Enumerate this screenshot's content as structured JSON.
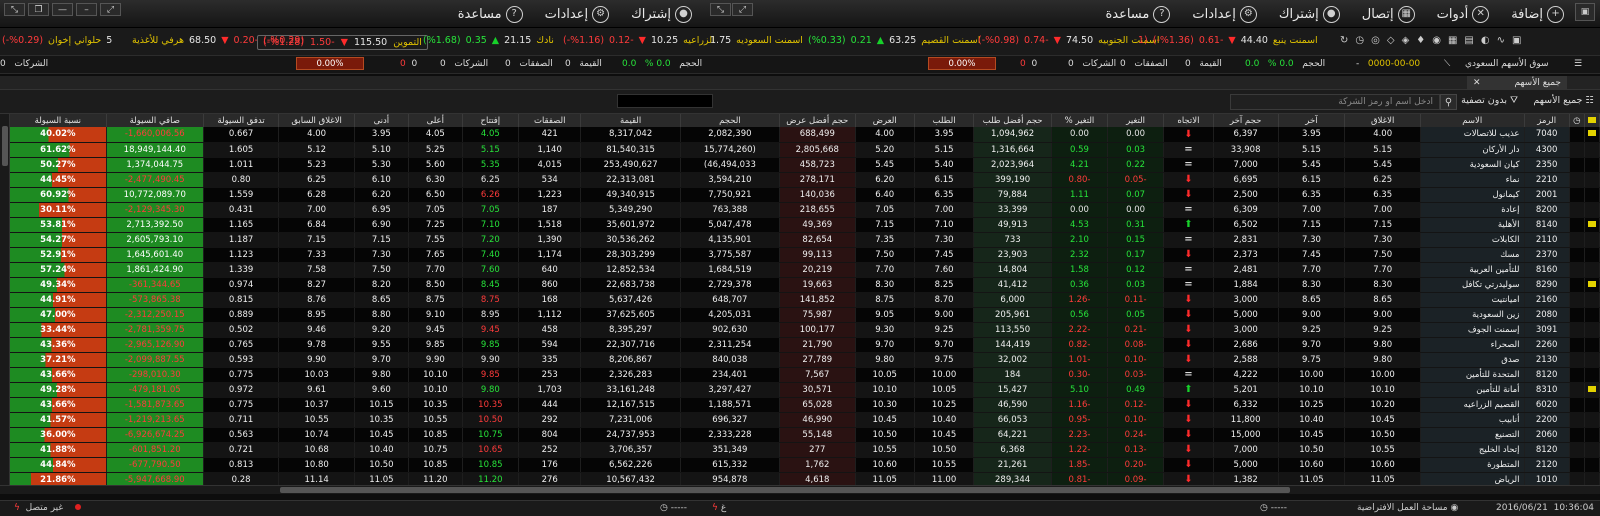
{
  "menu_right": [
    {
      "label": "إضافة",
      "icon": "add-window-icon"
    },
    {
      "label": "أدوات",
      "icon": "tools-icon"
    },
    {
      "label": "إتصال",
      "icon": "connection-icon"
    },
    {
      "label": "إشتراك",
      "icon": "subscription-icon"
    },
    {
      "label": "إعدادات",
      "icon": "gear-icon"
    },
    {
      "label": "مساعدة",
      "icon": "help-icon"
    }
  ],
  "menu_left": [
    {
      "label": "إشتراك",
      "icon": "subscription-icon"
    },
    {
      "label": "إعدادات",
      "icon": "gear-icon"
    },
    {
      "label": "مساعدة",
      "icon": "help-icon"
    }
  ],
  "ticker": [
    {
      "name": "حلواني إخوان",
      "value": "",
      "change": "-0.29",
      "pct": "(%0.29-)",
      "dir": "down"
    },
    {
      "name": "هرفي للأغذية",
      "value": "68.50",
      "change": "-0.20",
      "pct": "(%0.29-)",
      "dir": "down"
    },
    {
      "name": "التموين",
      "value": "115.50",
      "change": "-1.50",
      "pct": "(%1.28-)",
      "dir": "down"
    },
    {
      "name": "نادك",
      "value": "21.15",
      "change": "0.35",
      "pct": "(%1.68)",
      "dir": "up"
    },
    {
      "name": "الزراعيه",
      "value": "10.25",
      "change": "-0.12",
      "pct": "(%1.16-)",
      "dir": "down"
    },
    {
      "name": "اسمنت السعوديه",
      "value": "",
      "change": "",
      "pct": "",
      "dir": ""
    },
    {
      "name": "اسمنت القصيم",
      "value": "63.25",
      "change": "0.21",
      "pct": "(%0.33)",
      "dir": "up"
    },
    {
      "name": "اسمنت الجنوبيه",
      "value": "74.50",
      "change": "-0.74",
      "pct": "(%0.98-)",
      "dir": "down"
    },
    {
      "name": "اسمنت ينبع",
      "value": "44.40",
      "change": "-0.61",
      "pct": "(%1.36-)",
      "dir": "down"
    }
  ],
  "ticker_extra": {
    "a": "1.75",
    "b": "5",
    "c": "(1"
  },
  "stats_right": {
    "market": "سوق الأسهم السعودي",
    "date": "0000-00-00",
    "index": "0.0",
    "pct": "0.0 %",
    "volume_label": "الحجم",
    "volume": "0",
    "value_label": "القيمة",
    "value": "0",
    "deals_label": "الصفقات",
    "deals": "0",
    "companies_label": "الشركات",
    "companies": "0",
    "bar": "0.00%",
    "dash": "-"
  },
  "stats_left": {
    "index": "0.0",
    "pct": "0.0 %",
    "volume_label": "الحجم",
    "volume": "0",
    "value_label": "القيمة",
    "value": "0",
    "deals_label": "الصفقات",
    "deals": "0",
    "companies_label": "الشركات",
    "companies": "0",
    "bar": "0.00%"
  },
  "tab": {
    "label": "جميع الأسهم",
    "close": "✕"
  },
  "toolbar": {
    "all_stocks": "جميع الأسهم",
    "filter": "بدون تصفية",
    "search_placeholder": "ادخل اسم او رمز الشركة"
  },
  "columns": [
    "",
    "",
    "الرمز",
    "الاسم",
    "الاغلاق",
    "آخر",
    "حجم آخر",
    "الاتجاه",
    "التغير",
    "التغير %",
    "حجم أفضل طلب",
    "الطلب",
    "العرض",
    "حجم أفضل عرض",
    "الحجم",
    "القيمة",
    "الصفقات",
    "إفتتاح",
    "أعلى",
    "أدنى",
    "الاغلاق السابق",
    "تدفق السيولة",
    "صافي السيولة",
    "نسبة السيولة"
  ],
  "rows": [
    {
      "flag": true,
      "code": "7040",
      "name": "عذيب للاتصالات",
      "close": "4.00",
      "last": "3.95",
      "lastvol": "6,397",
      "dir": "down",
      "ch": "0.00",
      "pct": "0.00",
      "bidv": "1,094,962",
      "bid": "3.95",
      "ask": "4.00",
      "askv": "688,499",
      "vol": "2,082,390",
      "val": "8,317,042",
      "deals": "421",
      "open": "4.05",
      "high": "4.05",
      "low": "3.95",
      "prev": "4.00",
      "flow": "0.667",
      "net": "1,660,006.56-",
      "ratio": "40.02%",
      "r": 40,
      "cc": "w",
      "oc": "g"
    },
    {
      "flag": false,
      "code": "4300",
      "name": "دار الأركان",
      "close": "5.15",
      "last": "5.15",
      "lastvol": "33,908",
      "dir": "eq",
      "ch": "0.03",
      "pct": "0.59",
      "bidv": "1,316,664",
      "bid": "5.15",
      "ask": "5.20",
      "askv": "2,805,668",
      "vol": "(15,774,260",
      "val": "81,540,315",
      "deals": "1,140",
      "open": "5.15",
      "high": "5.25",
      "low": "5.10",
      "prev": "5.12",
      "flow": "1.605",
      "net": "18,949,144.40",
      "ratio": "61.62%",
      "r": 62,
      "cc": "g",
      "oc": "g"
    },
    {
      "flag": false,
      "code": "2350",
      "name": "كيان السعودية",
      "close": "5.45",
      "last": "5.45",
      "lastvol": "7,000",
      "dir": "eq",
      "ch": "0.22",
      "pct": "4.21",
      "bidv": "2,023,964",
      "bid": "5.40",
      "ask": "5.45",
      "askv": "458,723",
      "vol": "46,494,033)",
      "val": "253,490,627",
      "deals": "4,015",
      "open": "5.35",
      "high": "5.60",
      "low": "5.30",
      "prev": "5.23",
      "flow": "1.011",
      "net": "1,374,044.75",
      "ratio": "50.27%",
      "r": 50,
      "cc": "g",
      "oc": "g"
    },
    {
      "flag": false,
      "code": "2210",
      "name": "نماء",
      "close": "6.25",
      "last": "6.15",
      "lastvol": "6,695",
      "dir": "down",
      "ch": "-0.05",
      "pct": "-0.80",
      "bidv": "399,190",
      "bid": "6.15",
      "ask": "6.20",
      "askv": "278,171",
      "vol": "3,594,210",
      "val": "22,313,081",
      "deals": "534",
      "open": "6.25",
      "high": "6.30",
      "low": "6.10",
      "prev": "6.25",
      "flow": "0.80",
      "net": "2,477,490.45-",
      "ratio": "44.45%",
      "r": 44,
      "cc": "r",
      "oc": "w"
    },
    {
      "flag": false,
      "code": "2001",
      "name": "كيمانول",
      "close": "6.35",
      "last": "6.35",
      "lastvol": "2,500",
      "dir": "down",
      "ch": "0.07",
      "pct": "1.11",
      "bidv": "79,884",
      "bid": "6.35",
      "ask": "6.40",
      "askv": "140,036",
      "vol": "7,750,921",
      "val": "49,340,915",
      "deals": "1,223",
      "open": "6.26",
      "high": "6.50",
      "low": "6.20",
      "prev": "6.28",
      "flow": "1.559",
      "net": "10,772,089.70",
      "ratio": "60.92%",
      "r": 61,
      "cc": "g",
      "oc": "r"
    },
    {
      "flag": false,
      "code": "8200",
      "name": "إعادة",
      "close": "7.00",
      "last": "7.00",
      "lastvol": "6,309",
      "dir": "eq",
      "ch": "0.00",
      "pct": "0.00",
      "bidv": "33,399",
      "bid": "7.00",
      "ask": "7.05",
      "askv": "218,655",
      "vol": "763,388",
      "val": "5,349,290",
      "deals": "187",
      "open": "7.05",
      "high": "7.05",
      "low": "6.95",
      "prev": "7.00",
      "flow": "0.431",
      "net": "2,129,345.30-",
      "ratio": "30.11%",
      "r": 30,
      "cc": "w",
      "oc": "g"
    },
    {
      "flag": true,
      "code": "8140",
      "name": "الأهلية",
      "close": "7.15",
      "last": "7.15",
      "lastvol": "6,502",
      "dir": "up",
      "ch": "0.31",
      "pct": "4.53",
      "bidv": "49,913",
      "bid": "7.10",
      "ask": "7.15",
      "askv": "49,369",
      "vol": "5,047,478",
      "val": "35,601,972",
      "deals": "1,518",
      "open": "7.10",
      "high": "7.25",
      "low": "6.90",
      "prev": "6.84",
      "flow": "1.165",
      "net": "2,713,392.50",
      "ratio": "53.81%",
      "r": 54,
      "cc": "g",
      "oc": "g"
    },
    {
      "flag": false,
      "code": "2110",
      "name": "الكابلات",
      "close": "7.30",
      "last": "7.30",
      "lastvol": "2,831",
      "dir": "eq",
      "ch": "0.15",
      "pct": "2.10",
      "bidv": "733",
      "bid": "7.30",
      "ask": "7.35",
      "askv": "82,654",
      "vol": "4,135,901",
      "val": "30,536,262",
      "deals": "1,390",
      "open": "7.20",
      "high": "7.55",
      "low": "7.15",
      "prev": "7.15",
      "flow": "1.187",
      "net": "2,605,793.10",
      "ratio": "54.27%",
      "r": 54,
      "cc": "g",
      "oc": "g"
    },
    {
      "flag": false,
      "code": "2370",
      "name": "مسك",
      "close": "7.50",
      "last": "7.45",
      "lastvol": "2,373",
      "dir": "down",
      "ch": "0.17",
      "pct": "2.32",
      "bidv": "23,903",
      "bid": "7.45",
      "ask": "7.50",
      "askv": "99,113",
      "vol": "3,775,587",
      "val": "28,303,299",
      "deals": "1,174",
      "open": "7.40",
      "high": "7.65",
      "low": "7.30",
      "prev": "7.33",
      "flow": "1.123",
      "net": "1,645,601.40",
      "ratio": "52.91%",
      "r": 53,
      "cc": "g",
      "oc": "g"
    },
    {
      "flag": false,
      "code": "8160",
      "name": "للتأمين العربية",
      "close": "7.70",
      "last": "7.70",
      "lastvol": "2,481",
      "dir": "eq",
      "ch": "0.12",
      "pct": "1.58",
      "bidv": "14,804",
      "bid": "7.60",
      "ask": "7.70",
      "askv": "20,219",
      "vol": "1,684,519",
      "val": "12,852,534",
      "deals": "640",
      "open": "7.60",
      "high": "7.70",
      "low": "7.50",
      "prev": "7.58",
      "flow": "1.339",
      "net": "1,861,424.90",
      "ratio": "57.24%",
      "r": 57,
      "cc": "g",
      "oc": "g"
    },
    {
      "flag": true,
      "code": "8290",
      "name": "سوليدرتي تكافل",
      "close": "8.30",
      "last": "8.30",
      "lastvol": "1,884",
      "dir": "eq",
      "ch": "0.03",
      "pct": "0.36",
      "bidv": "41,412",
      "bid": "8.25",
      "ask": "8.30",
      "askv": "19,663",
      "vol": "2,729,378",
      "val": "22,683,738",
      "deals": "860",
      "open": "8.45",
      "high": "8.50",
      "low": "8.20",
      "prev": "8.27",
      "flow": "0.974",
      "net": "361,344.65-",
      "ratio": "49.34%",
      "r": 49,
      "cc": "g",
      "oc": "g"
    },
    {
      "flag": false,
      "code": "2160",
      "name": "اميانتيت",
      "close": "8.65",
      "last": "8.65",
      "lastvol": "3,000",
      "dir": "down",
      "ch": "-0.11",
      "pct": "-1.26",
      "bidv": "6,000",
      "bid": "8.70",
      "ask": "8.75",
      "askv": "141,852",
      "vol": "648,707",
      "val": "5,637,426",
      "deals": "168",
      "open": "8.75",
      "high": "8.75",
      "low": "8.65",
      "prev": "8.76",
      "flow": "0.815",
      "net": "573,865.38-",
      "ratio": "44.91%",
      "r": 45,
      "cc": "r",
      "oc": "r"
    },
    {
      "flag": false,
      "code": "2080",
      "name": "زين السعودية",
      "close": "9.00",
      "last": "9.00",
      "lastvol": "5,000",
      "dir": "down",
      "ch": "0.05",
      "pct": "0.56",
      "bidv": "205,961",
      "bid": "9.00",
      "ask": "9.05",
      "askv": "75,987",
      "vol": "4,205,031",
      "val": "37,625,605",
      "deals": "1,112",
      "open": "8.95",
      "high": "9.10",
      "low": "8.80",
      "prev": "8.95",
      "flow": "0.889",
      "net": "2,312,250.15-",
      "ratio": "47.00%",
      "r": 47,
      "cc": "g",
      "oc": "w"
    },
    {
      "flag": false,
      "code": "3091",
      "name": "إسمنت الجوف",
      "close": "9.25",
      "last": "9.25",
      "lastvol": "3,000",
      "dir": "down",
      "ch": "-0.21",
      "pct": "-2.22",
      "bidv": "113,550",
      "bid": "9.25",
      "ask": "9.30",
      "askv": "100,177",
      "vol": "902,630",
      "val": "8,395,297",
      "deals": "458",
      "open": "9.45",
      "high": "9.45",
      "low": "9.20",
      "prev": "9.46",
      "flow": "0.502",
      "net": "2,781,359.75-",
      "ratio": "33.44%",
      "r": 33,
      "cc": "r",
      "oc": "r"
    },
    {
      "flag": false,
      "code": "2260",
      "name": "الصحراء",
      "close": "9.80",
      "last": "9.70",
      "lastvol": "2,686",
      "dir": "down",
      "ch": "-0.08",
      "pct": "-0.82",
      "bidv": "144,419",
      "bid": "9.70",
      "ask": "9.70",
      "askv": "21,790",
      "vol": "2,311,254",
      "val": "22,307,716",
      "deals": "594",
      "open": "9.85",
      "high": "9.85",
      "low": "9.55",
      "prev": "9.78",
      "flow": "0.765",
      "net": "2,965,126.90-",
      "ratio": "43.36%",
      "r": 43,
      "cc": "r",
      "oc": "g"
    },
    {
      "flag": false,
      "code": "2130",
      "name": "صدق",
      "close": "9.80",
      "last": "9.75",
      "lastvol": "2,588",
      "dir": "down",
      "ch": "-0.10",
      "pct": "-1.01",
      "bidv": "32,002",
      "bid": "9.75",
      "ask": "9.80",
      "askv": "27,789",
      "vol": "840,038",
      "val": "8,206,867",
      "deals": "335",
      "open": "9.90",
      "high": "9.90",
      "low": "9.70",
      "prev": "9.90",
      "flow": "0.593",
      "net": "2,099,887.55-",
      "ratio": "37.21%",
      "r": 37,
      "cc": "r",
      "oc": "w"
    },
    {
      "flag": false,
      "code": "8120",
      "name": "المتحدة للتأمين",
      "close": "10.00",
      "last": "10.00",
      "lastvol": "4,222",
      "dir": "eq",
      "ch": "-0.03",
      "pct": "-0.30",
      "bidv": "184",
      "bid": "10.00",
      "ask": "10.05",
      "askv": "7,567",
      "vol": "234,401",
      "val": "2,326,283",
      "deals": "253",
      "open": "9.85",
      "high": "10.10",
      "low": "9.80",
      "prev": "10.03",
      "flow": "0.775",
      "net": "298,010.30-",
      "ratio": "43.66%",
      "r": 44,
      "cc": "r",
      "oc": "r"
    },
    {
      "flag": true,
      "code": "8310",
      "name": "أمانة للتأمين",
      "close": "10.10",
      "last": "10.10",
      "lastvol": "5,201",
      "dir": "up",
      "ch": "0.49",
      "pct": "5.10",
      "bidv": "15,427",
      "bid": "10.05",
      "ask": "10.10",
      "askv": "30,571",
      "vol": "3,297,427",
      "val": "33,161,248",
      "deals": "1,703",
      "open": "9.80",
      "high": "10.10",
      "low": "9.60",
      "prev": "9.61",
      "flow": "0.972",
      "net": "479,181.05-",
      "ratio": "49.28%",
      "r": 49,
      "cc": "g",
      "oc": "g"
    },
    {
      "flag": false,
      "code": "6020",
      "name": "القصيم الزراعيه",
      "close": "10.20",
      "last": "10.25",
      "lastvol": "6,332",
      "dir": "down",
      "ch": "-0.12",
      "pct": "-1.16",
      "bidv": "46,590",
      "bid": "10.25",
      "ask": "10.30",
      "askv": "65,028",
      "vol": "1,188,571",
      "val": "12,167,515",
      "deals": "444",
      "open": "10.35",
      "high": "10.35",
      "low": "10.15",
      "prev": "10.37",
      "flow": "0.775",
      "net": "1,581,873.65-",
      "ratio": "43.66%",
      "r": 44,
      "cc": "r",
      "oc": "r"
    },
    {
      "flag": false,
      "code": "2200",
      "name": "أنابيب",
      "close": "10.45",
      "last": "10.40",
      "lastvol": "11,800",
      "dir": "down",
      "ch": "-0.10",
      "pct": "-0.95",
      "bidv": "66,053",
      "bid": "10.40",
      "ask": "10.45",
      "askv": "46,990",
      "vol": "696,327",
      "val": "7,231,006",
      "deals": "292",
      "open": "10.50",
      "high": "10.55",
      "low": "10.35",
      "prev": "10.55",
      "flow": "0.711",
      "net": "1,219,213.65-",
      "ratio": "41.57%",
      "r": 42,
      "cc": "r",
      "oc": "r"
    },
    {
      "flag": false,
      "code": "2060",
      "name": "التصنيع",
      "close": "10.50",
      "last": "10.45",
      "lastvol": "15,000",
      "dir": "down",
      "ch": "-0.24",
      "pct": "-2.23",
      "bidv": "64,221",
      "bid": "10.45",
      "ask": "10.50",
      "askv": "55,148",
      "vol": "2,333,228",
      "val": "24,737,953",
      "deals": "804",
      "open": "10.75",
      "high": "10.85",
      "low": "10.45",
      "prev": "10.74",
      "flow": "0.563",
      "net": "6,926,674.25-",
      "ratio": "36.00%",
      "r": 36,
      "cc": "r",
      "oc": "g"
    },
    {
      "flag": false,
      "code": "8120",
      "name": "إتحاد الخليج",
      "close": "10.55",
      "last": "10.50",
      "lastvol": "7,000",
      "dir": "down",
      "ch": "-0.13",
      "pct": "-1.22",
      "bidv": "6,368",
      "bid": "10.50",
      "ask": "10.55",
      "askv": "277",
      "vol": "351,349",
      "val": "3,706,357",
      "deals": "252",
      "open": "10.65",
      "high": "10.75",
      "low": "10.40",
      "prev": "10.68",
      "flow": "0.721",
      "net": "601,851.20-",
      "ratio": "41.88%",
      "r": 42,
      "cc": "r",
      "oc": "r"
    },
    {
      "flag": false,
      "code": "2120",
      "name": "المتطورة",
      "close": "10.60",
      "last": "10.60",
      "lastvol": "5,000",
      "dir": "down",
      "ch": "-0.20",
      "pct": "-1.85",
      "bidv": "21,261",
      "bid": "10.55",
      "ask": "10.60",
      "askv": "1,762",
      "vol": "615,332",
      "val": "6,562,226",
      "deals": "176",
      "open": "10.85",
      "high": "10.85",
      "low": "10.50",
      "prev": "10.80",
      "flow": "0.813",
      "net": "677,790.50-",
      "ratio": "44.84%",
      "r": 45,
      "cc": "r",
      "oc": "g"
    },
    {
      "flag": false,
      "code": "1010",
      "name": "الرياض",
      "close": "11.05",
      "last": "11.05",
      "lastvol": "1,382",
      "dir": "down",
      "ch": "-0.09",
      "pct": "-0.81",
      "bidv": "289,344",
      "bid": "11.00",
      "ask": "11.05",
      "askv": "4,618",
      "vol": "954,878",
      "val": "10,567,432",
      "deals": "276",
      "open": "11.20",
      "high": "11.20",
      "low": "11.05",
      "prev": "11.14",
      "flow": "0.28",
      "net": "5,947,668.90-",
      "ratio": "21.86%",
      "r": 22,
      "cc": "r",
      "oc": "g"
    }
  ],
  "status": {
    "time": "10:36:04",
    "date": "2016/06/21",
    "workspace": "مساحة العمل الافتراضية",
    "dash1": "-----",
    "na": "غ",
    "dash2": "-----",
    "conn": "غير متصل"
  }
}
